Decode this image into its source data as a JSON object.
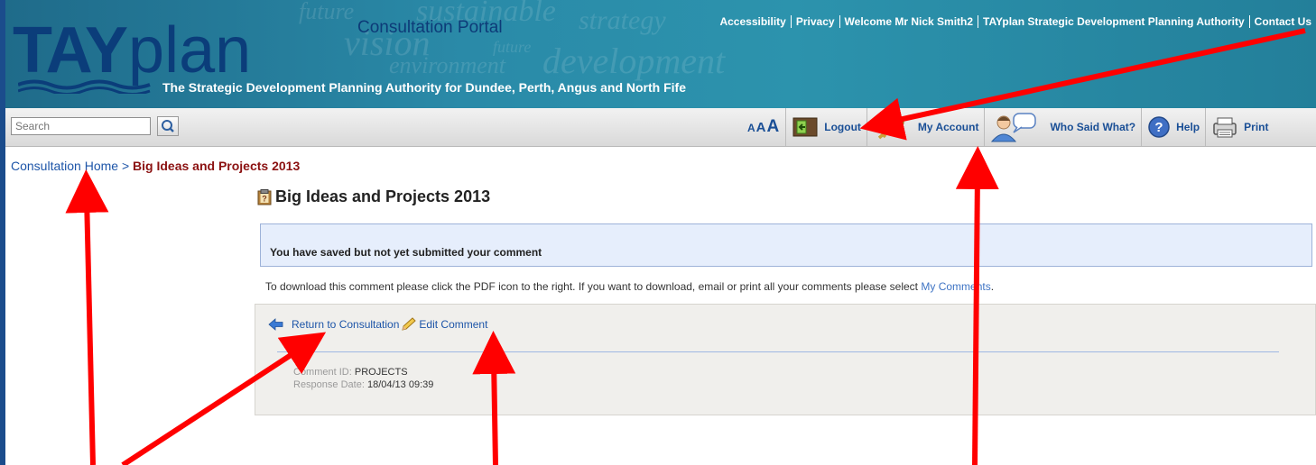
{
  "header": {
    "logo_tay": "TAY",
    "logo_plan": "plan",
    "portal_title": "Consultation Portal",
    "tagline": "The Strategic Development Planning Authority for Dundee, Perth, Angus and North Fife",
    "background_words": [
      "future",
      "sustainable",
      "strategy",
      "vision",
      "future",
      "environment",
      "development"
    ],
    "top_links": [
      "Accessibility",
      "Privacy",
      "Welcome Mr Nick Smith2",
      "TAYplan Strategic Development Planning Authority",
      "Contact Us"
    ]
  },
  "toolbar": {
    "search_placeholder": "Search",
    "text_size_label": "AAA",
    "logout": "Logout",
    "my_account": "My Account",
    "who_said_what": "Who Said What?",
    "help": "Help",
    "print": "Print"
  },
  "breadcrumb": {
    "home": "Consultation Home",
    "separator": ">",
    "current": "Big Ideas and Projects 2013"
  },
  "page": {
    "title": "Big Ideas and Projects 2013",
    "notice": "You have saved but not yet submitted your comment",
    "instructions": "To download this comment please click the PDF icon to the right. If you want to download, email or print all your comments please select",
    "my_comments_link": "My Comments",
    "return_link": "Return to Consultation",
    "edit_link": "Edit Comment",
    "comment_id_label": "Comment ID:",
    "comment_id_value": "PROJECTS",
    "response_date_label": "Response Date:",
    "response_date_value": "18/04/13 09:39"
  },
  "colors": {
    "frame": "#1b4c8c",
    "banner": "#2a8aa8",
    "link": "#1d55a8",
    "breadcrumb_current": "#8b1111",
    "notice_bg": "#e6eefc",
    "annotation_arrow": "#ff0000"
  },
  "icons": [
    "search-icon",
    "logout-door-icon",
    "key-icon",
    "user-speech-icon",
    "help-icon",
    "printer-icon",
    "clipboard-icon",
    "back-arrow-icon",
    "pencil-icon"
  ]
}
